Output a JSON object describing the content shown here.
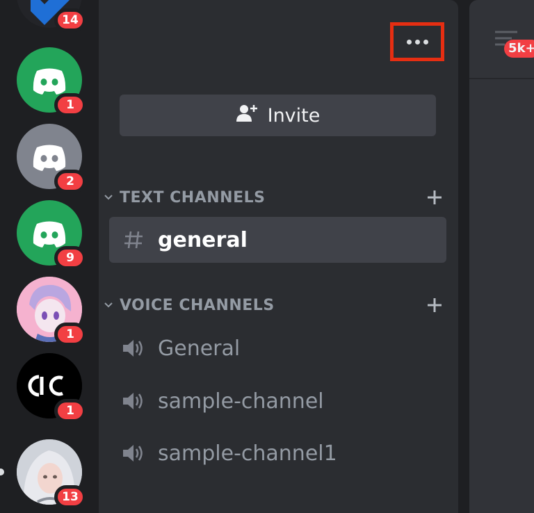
{
  "servers": [
    {
      "name": "server-top",
      "badge": "14",
      "color": "#1e1f22"
    },
    {
      "name": "server-discord-green-1",
      "badge": "1",
      "color": "#23a55a"
    },
    {
      "name": "server-discord-gray",
      "badge": "2",
      "color": "#80848e"
    },
    {
      "name": "server-discord-green-2",
      "badge": "9",
      "color": "#23a55a"
    },
    {
      "name": "server-anime-avatar",
      "badge": "1",
      "color": "#f3a7c8"
    },
    {
      "name": "server-dc-logo",
      "badge": "1",
      "color": "#000000"
    },
    {
      "name": "server-photo-avatar",
      "badge": "13",
      "color": "#c9ced6"
    }
  ],
  "header": {
    "more_icon": "more-horizontal-icon"
  },
  "invite": {
    "label": "Invite",
    "icon": "add-person-icon"
  },
  "categories": {
    "text": {
      "label": "TEXT CHANNELS"
    },
    "voice": {
      "label": "VOICE CHANNELS"
    }
  },
  "text_channels": [
    {
      "label": "general",
      "active": true
    }
  ],
  "voice_channels": [
    {
      "label": "General"
    },
    {
      "label": "sample-channel"
    },
    {
      "label": "sample-channel1"
    }
  ],
  "main": {
    "threads_badge": "5k+"
  },
  "colors": {
    "rail_bg": "#1e1f22",
    "sidebar_bg": "#2b2d31",
    "active_bg": "#404249",
    "badge_red": "#f23f43",
    "highlight_box": "#e62e12",
    "discord_green": "#23a55a"
  }
}
